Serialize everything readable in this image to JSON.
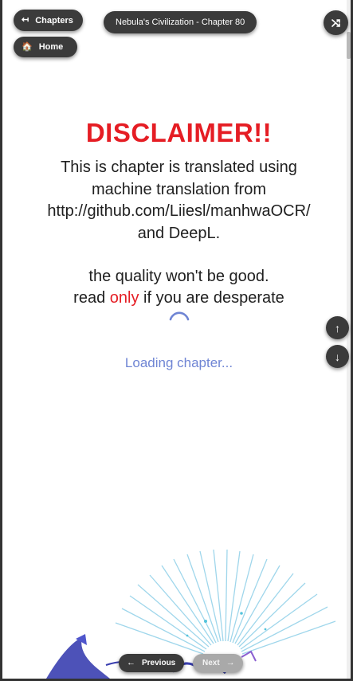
{
  "header": {
    "chapters_label": "Chapters",
    "chapters_icon": "↤",
    "home_label": "Home",
    "home_icon": "🏠",
    "title": "Nebula's Civilization - Chapter 80",
    "shuffle_icon": "⤮"
  },
  "content": {
    "disclaimer_title": "DISCLAIMER!!",
    "line1": "This is chapter is translated using",
    "line2": "machine translation from",
    "line3": "http://github.com/Liiesl/manhwaOCR/",
    "line4": "and DeepL.",
    "line5": "the quality won't be good.",
    "line6_pre": "read ",
    "line6_red": "only",
    "line6_post": " if you are desperate",
    "loading": "Loading chapter..."
  },
  "scroll_controls": {
    "up_icon": "↑",
    "down_icon": "↓"
  },
  "footer": {
    "prev_icon": "←",
    "prev_label": "Previous",
    "next_label": "Next",
    "next_icon": "→"
  },
  "colors": {
    "accent_red": "#e51d24",
    "loading_blue": "#6f85d4",
    "pill_bg": "#3b3b3b"
  }
}
